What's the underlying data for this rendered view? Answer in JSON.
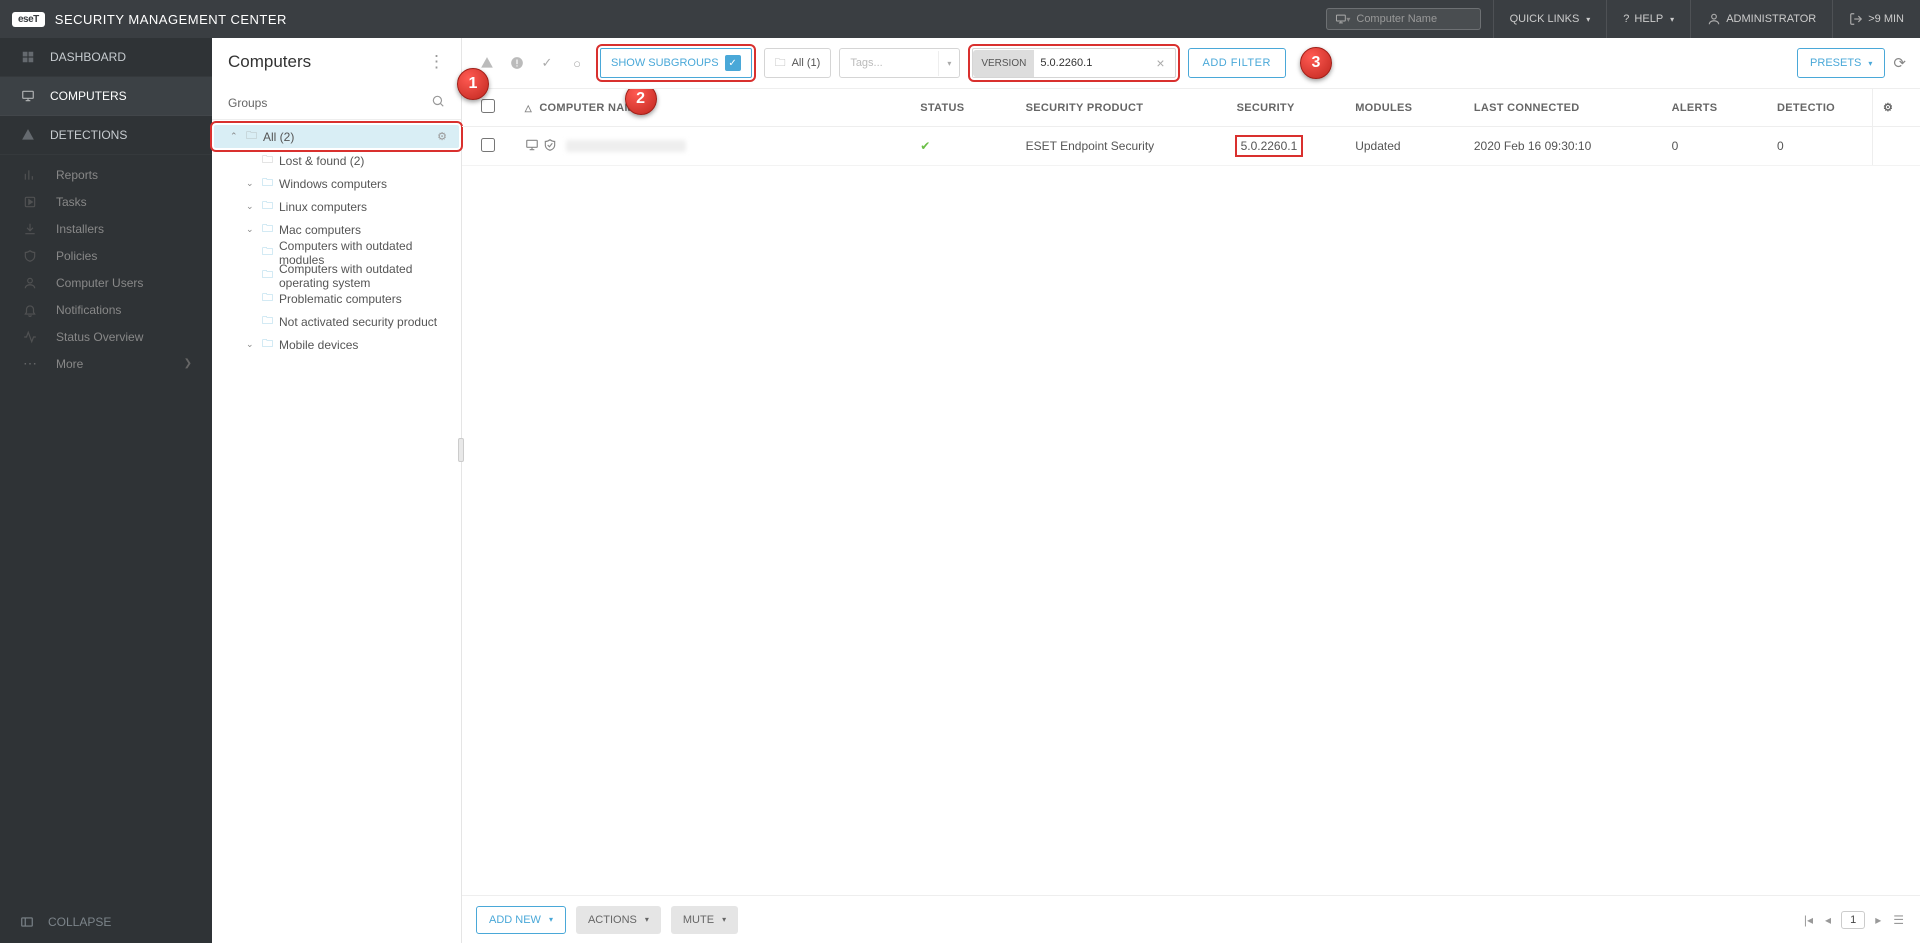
{
  "topbar": {
    "brand_logo_text": "eseT",
    "brand_title": "SECURITY MANAGEMENT CENTER",
    "search_placeholder": "Computer Name",
    "quick_links": "QUICK LINKS",
    "help": "HELP",
    "user": "ADMINISTRATOR",
    "time": ">9 MIN"
  },
  "leftnav": {
    "items": [
      {
        "label": "DASHBOARD",
        "icon": "dashboard"
      },
      {
        "label": "COMPUTERS",
        "icon": "monitor",
        "active": true
      },
      {
        "label": "DETECTIONS",
        "icon": "alert"
      }
    ],
    "subitems": [
      {
        "label": "Reports",
        "icon": "chart"
      },
      {
        "label": "Tasks",
        "icon": "play"
      },
      {
        "label": "Installers",
        "icon": "download"
      },
      {
        "label": "Policies",
        "icon": "shield"
      },
      {
        "label": "Computer Users",
        "icon": "user"
      },
      {
        "label": "Notifications",
        "icon": "bell"
      },
      {
        "label": "Status Overview",
        "icon": "pulse"
      },
      {
        "label": "More",
        "icon": "dots"
      }
    ],
    "collapse": "COLLAPSE"
  },
  "groups": {
    "title": "Computers",
    "header": "Groups",
    "tree": {
      "root": "All (2)",
      "children": [
        {
          "label": "Lost & found (2)"
        },
        {
          "label": "Windows computers",
          "expandable": true
        },
        {
          "label": "Linux computers",
          "expandable": true
        },
        {
          "label": "Mac computers",
          "expandable": true
        },
        {
          "label": "Computers with outdated modules"
        },
        {
          "label": "Computers with outdated operating system"
        },
        {
          "label": "Problematic computers"
        },
        {
          "label": "Not activated security product"
        },
        {
          "label": "Mobile devices",
          "expandable": true
        }
      ]
    }
  },
  "filters": {
    "show_subgroups": "SHOW SUBGROUPS",
    "all_chip": "All (1)",
    "tags_placeholder": "Tags...",
    "version_label": "VERSION",
    "version_value": "5.0.2260.1",
    "add_filter": "ADD FILTER",
    "presets": "PRESETS"
  },
  "columns": {
    "name": "COMPUTER NAME",
    "status": "STATUS",
    "product": "SECURITY PRODUCT",
    "version": "SECURITY",
    "modules": "MODULES",
    "connected": "LAST CONNECTED",
    "alerts": "ALERTS",
    "detections": "DETECTIO"
  },
  "rows": [
    {
      "name_hidden": true,
      "status_ok": true,
      "product": "ESET Endpoint Security",
      "version": "5.0.2260.1",
      "modules": "Updated",
      "connected": "2020 Feb 16 09:30:10",
      "alerts": "0",
      "detections": "0"
    }
  ],
  "bottom": {
    "add": "ADD NEW",
    "actions": "ACTIONS",
    "mute": "MUTE",
    "page": "1"
  },
  "callouts": {
    "c1": "1",
    "c2": "2",
    "c3": "3"
  }
}
